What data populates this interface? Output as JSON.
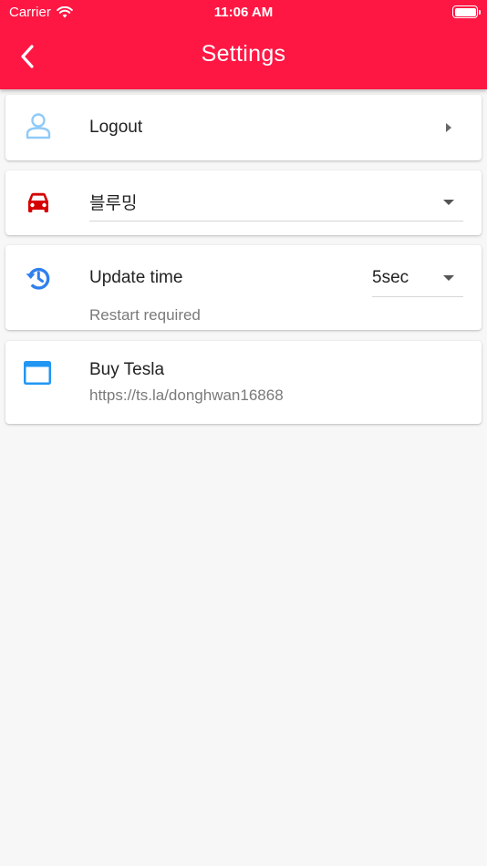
{
  "status_bar": {
    "carrier": "Carrier",
    "time": "11:06 AM"
  },
  "header": {
    "title": "Settings",
    "color": "#ff1744"
  },
  "items": {
    "logout": {
      "label": "Logout",
      "icon": "person-icon",
      "icon_color": "#90caf9"
    },
    "vehicle": {
      "selected": "블루밍",
      "icon": "car-icon",
      "icon_color": "#d50000"
    },
    "update_time": {
      "label": "Update time",
      "selected": "5sec",
      "subtitle": "Restart required",
      "icon": "history-icon",
      "icon_color": "#2f80ed"
    },
    "buy_tesla": {
      "label": "Buy Tesla",
      "url": "https://ts.la/donghwan16868",
      "icon": "browser-window-icon",
      "icon_color": "#2196f3"
    }
  }
}
